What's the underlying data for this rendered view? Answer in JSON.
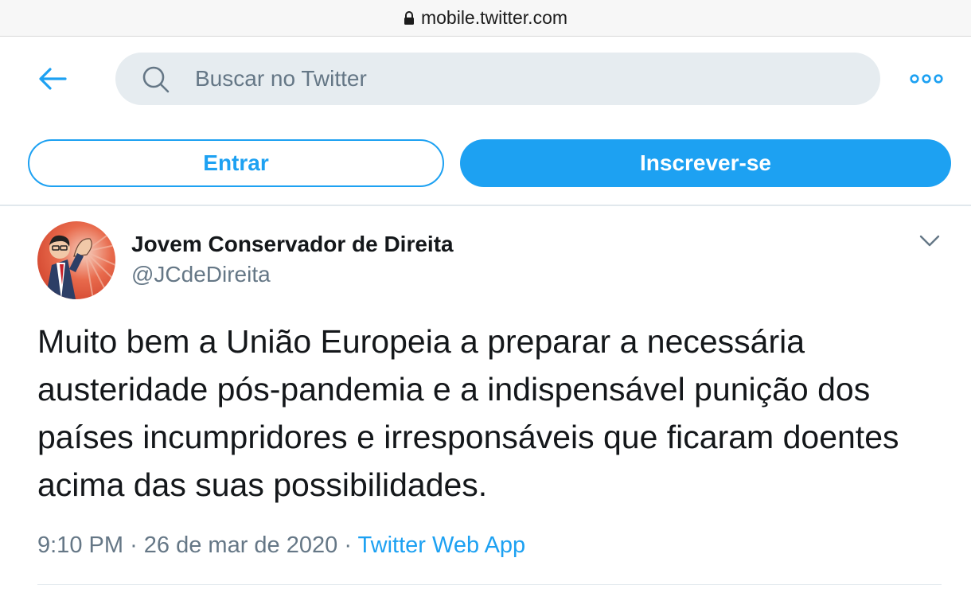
{
  "browser": {
    "url": "mobile.twitter.com"
  },
  "header": {
    "search_placeholder": "Buscar no Twitter"
  },
  "auth": {
    "login_label": "Entrar",
    "signup_label": "Inscrever-se"
  },
  "tweet": {
    "author_name": "Jovem Conservador de Direita",
    "author_handle": "@JCdeDireita",
    "text": "Muito bem a União Europeia a preparar a necessária austeridade pós-pandemia e a indispensável punição dos países incumpridores e irresponsáveis que ficaram doentes acima das suas possibilidades.",
    "time": "9:10 PM",
    "date": "26 de mar de 2020",
    "separator": "·",
    "source": "Twitter Web App"
  },
  "colors": {
    "accent": "#1da1f2",
    "muted": "#657786",
    "search_bg": "#e6ecf0"
  },
  "icons": {
    "back": "arrow-left-icon",
    "search": "search-icon",
    "more": "more-dots-icon",
    "caret": "chevron-down-icon",
    "lock": "lock-icon"
  }
}
